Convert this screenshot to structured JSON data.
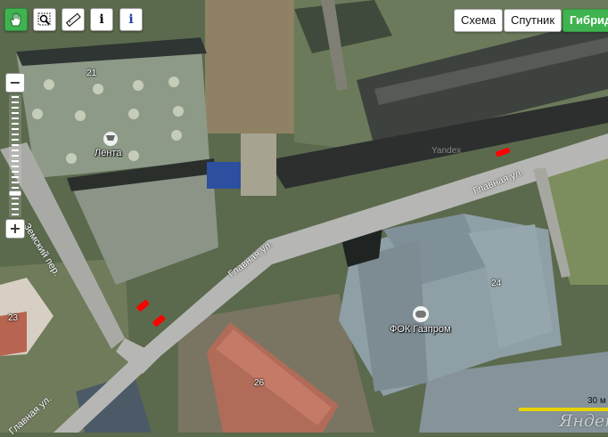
{
  "toolbar": {
    "hand_icon": "hand-icon",
    "zoom_area_icon": "zoom-area-icon",
    "ruler_icon": "ruler-icon",
    "info_label": "i",
    "info2_label": "i"
  },
  "layers": {
    "scheme": "Схема",
    "satellite": "Спутник",
    "hybrid": "Гибрид",
    "active": "Гибрид"
  },
  "zoom": {
    "plus": "+",
    "minus": "−",
    "level_fraction": 0.82
  },
  "map": {
    "pois": {
      "lenta": "Лента",
      "fok": "ФОК Газпром"
    },
    "house_numbers": {
      "n21": "21",
      "n23": "23",
      "n24": "24",
      "n26": "26"
    },
    "streets": {
      "glavnaya_1": "Главная ул.",
      "glavnaya_2": "Главная ул.",
      "glavnaya_3": "Главная ул.",
      "zemsky": "Земский пер."
    },
    "watermark": "Yandex"
  },
  "scale": {
    "label": "30 м"
  },
  "logo": "Яндекс",
  "colors": {
    "active_green": "#3fb34f",
    "road": "#b7b7b7",
    "traffic_red": "#ff0000"
  }
}
